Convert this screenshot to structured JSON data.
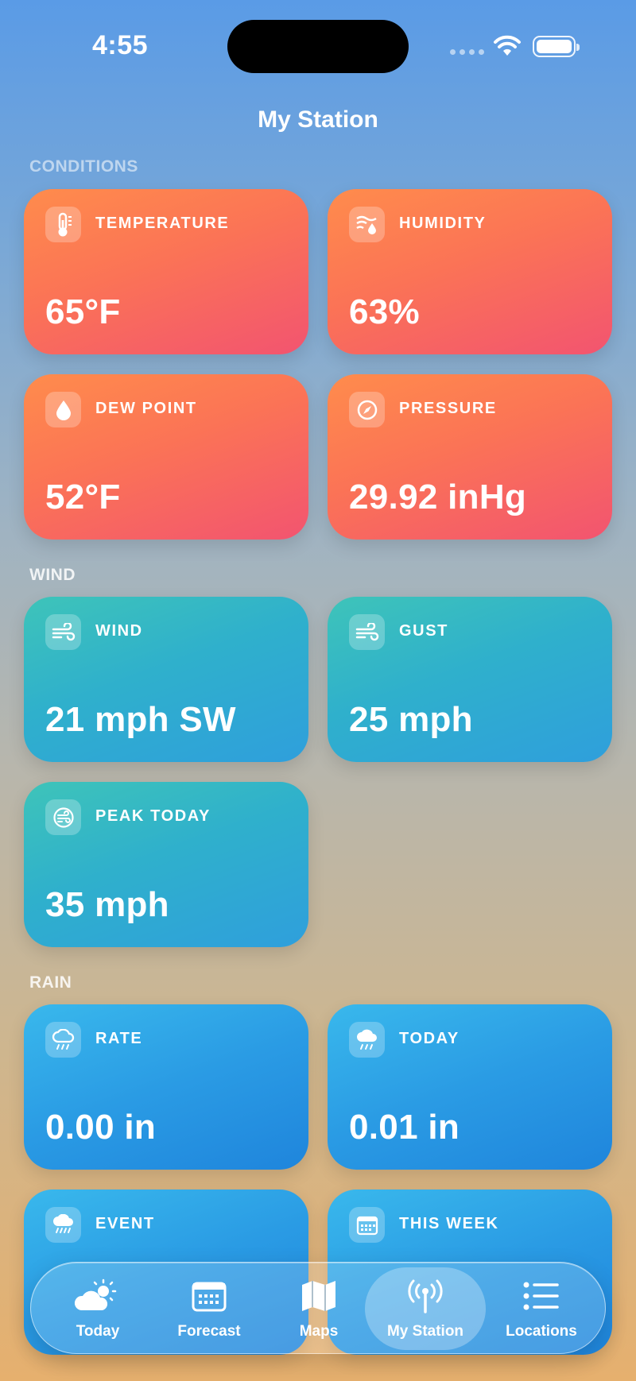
{
  "status_bar": {
    "time": "4:55"
  },
  "header": {
    "title": "My Station"
  },
  "sections": {
    "conditions": "CONDITIONS",
    "wind": "WIND",
    "rain": "RAIN"
  },
  "cards": {
    "temperature": {
      "label": "TEMPERATURE",
      "value": "65°F",
      "icon": "thermometer-icon"
    },
    "humidity": {
      "label": "HUMIDITY",
      "value": "63%",
      "icon": "humidity-icon"
    },
    "dew_point": {
      "label": "DEW POINT",
      "value": "52°F",
      "icon": "drop-icon"
    },
    "pressure": {
      "label": "PRESSURE",
      "value": "29.92 inHg",
      "icon": "gauge-icon"
    },
    "wind": {
      "label": "WIND",
      "value": "21 mph SW",
      "icon": "wind-icon"
    },
    "gust": {
      "label": "GUST",
      "value": "25 mph",
      "icon": "wind-icon"
    },
    "peak_today": {
      "label": "PEAK TODAY",
      "value": "35 mph",
      "icon": "wind-circle-icon"
    },
    "rain_rate": {
      "label": "RATE",
      "value": "0.00 in",
      "icon": "cloud-rain-icon"
    },
    "rain_today": {
      "label": "TODAY",
      "value": "0.01 in",
      "icon": "cloud-rain-icon"
    },
    "rain_event": {
      "label": "EVENT",
      "value": "",
      "icon": "cloud-heavy-rain-icon"
    },
    "rain_week": {
      "label": "THIS WEEK",
      "value": "",
      "icon": "calendar-icon"
    }
  },
  "tabs": [
    {
      "label": "Today",
      "icon": "cloud-sun-icon"
    },
    {
      "label": "Forecast",
      "icon": "calendar-grid-icon"
    },
    {
      "label": "Maps",
      "icon": "map-icon"
    },
    {
      "label": "My Station",
      "icon": "antenna-icon",
      "active": true
    },
    {
      "label": "Locations",
      "icon": "list-icon"
    }
  ],
  "colors": {
    "warm_card": "#fb7356",
    "teal_card": "#2fb0cc",
    "blue_card": "#2a9be4"
  }
}
